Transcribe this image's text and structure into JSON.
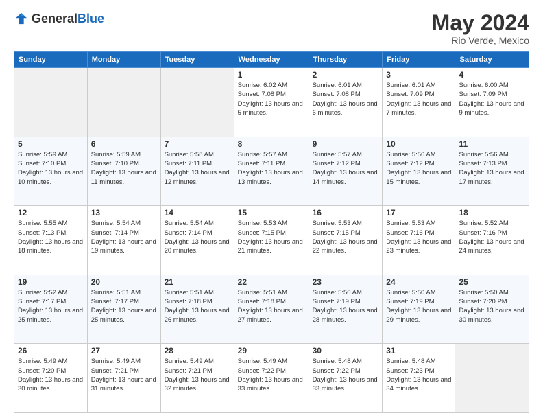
{
  "logo": {
    "general": "General",
    "blue": "Blue"
  },
  "header": {
    "month": "May 2024",
    "location": "Rio Verde, Mexico"
  },
  "weekdays": [
    "Sunday",
    "Monday",
    "Tuesday",
    "Wednesday",
    "Thursday",
    "Friday",
    "Saturday"
  ],
  "weeks": [
    [
      {
        "day": "",
        "empty": true
      },
      {
        "day": "",
        "empty": true
      },
      {
        "day": "",
        "empty": true
      },
      {
        "day": "1",
        "sunrise": "6:02 AM",
        "sunset": "7:08 PM",
        "daylight": "13 hours and 5 minutes."
      },
      {
        "day": "2",
        "sunrise": "6:01 AM",
        "sunset": "7:08 PM",
        "daylight": "13 hours and 6 minutes."
      },
      {
        "day": "3",
        "sunrise": "6:01 AM",
        "sunset": "7:09 PM",
        "daylight": "13 hours and 7 minutes."
      },
      {
        "day": "4",
        "sunrise": "6:00 AM",
        "sunset": "7:09 PM",
        "daylight": "13 hours and 9 minutes."
      }
    ],
    [
      {
        "day": "5",
        "sunrise": "5:59 AM",
        "sunset": "7:10 PM",
        "daylight": "13 hours and 10 minutes."
      },
      {
        "day": "6",
        "sunrise": "5:59 AM",
        "sunset": "7:10 PM",
        "daylight": "13 hours and 11 minutes."
      },
      {
        "day": "7",
        "sunrise": "5:58 AM",
        "sunset": "7:11 PM",
        "daylight": "13 hours and 12 minutes."
      },
      {
        "day": "8",
        "sunrise": "5:57 AM",
        "sunset": "7:11 PM",
        "daylight": "13 hours and 13 minutes."
      },
      {
        "day": "9",
        "sunrise": "5:57 AM",
        "sunset": "7:12 PM",
        "daylight": "13 hours and 14 minutes."
      },
      {
        "day": "10",
        "sunrise": "5:56 AM",
        "sunset": "7:12 PM",
        "daylight": "13 hours and 15 minutes."
      },
      {
        "day": "11",
        "sunrise": "5:56 AM",
        "sunset": "7:13 PM",
        "daylight": "13 hours and 17 minutes."
      }
    ],
    [
      {
        "day": "12",
        "sunrise": "5:55 AM",
        "sunset": "7:13 PM",
        "daylight": "13 hours and 18 minutes."
      },
      {
        "day": "13",
        "sunrise": "5:54 AM",
        "sunset": "7:14 PM",
        "daylight": "13 hours and 19 minutes."
      },
      {
        "day": "14",
        "sunrise": "5:54 AM",
        "sunset": "7:14 PM",
        "daylight": "13 hours and 20 minutes."
      },
      {
        "day": "15",
        "sunrise": "5:53 AM",
        "sunset": "7:15 PM",
        "daylight": "13 hours and 21 minutes."
      },
      {
        "day": "16",
        "sunrise": "5:53 AM",
        "sunset": "7:15 PM",
        "daylight": "13 hours and 22 minutes."
      },
      {
        "day": "17",
        "sunrise": "5:53 AM",
        "sunset": "7:16 PM",
        "daylight": "13 hours and 23 minutes."
      },
      {
        "day": "18",
        "sunrise": "5:52 AM",
        "sunset": "7:16 PM",
        "daylight": "13 hours and 24 minutes."
      }
    ],
    [
      {
        "day": "19",
        "sunrise": "5:52 AM",
        "sunset": "7:17 PM",
        "daylight": "13 hours and 25 minutes."
      },
      {
        "day": "20",
        "sunrise": "5:51 AM",
        "sunset": "7:17 PM",
        "daylight": "13 hours and 25 minutes."
      },
      {
        "day": "21",
        "sunrise": "5:51 AM",
        "sunset": "7:18 PM",
        "daylight": "13 hours and 26 minutes."
      },
      {
        "day": "22",
        "sunrise": "5:51 AM",
        "sunset": "7:18 PM",
        "daylight": "13 hours and 27 minutes."
      },
      {
        "day": "23",
        "sunrise": "5:50 AM",
        "sunset": "7:19 PM",
        "daylight": "13 hours and 28 minutes."
      },
      {
        "day": "24",
        "sunrise": "5:50 AM",
        "sunset": "7:19 PM",
        "daylight": "13 hours and 29 minutes."
      },
      {
        "day": "25",
        "sunrise": "5:50 AM",
        "sunset": "7:20 PM",
        "daylight": "13 hours and 30 minutes."
      }
    ],
    [
      {
        "day": "26",
        "sunrise": "5:49 AM",
        "sunset": "7:20 PM",
        "daylight": "13 hours and 30 minutes."
      },
      {
        "day": "27",
        "sunrise": "5:49 AM",
        "sunset": "7:21 PM",
        "daylight": "13 hours and 31 minutes."
      },
      {
        "day": "28",
        "sunrise": "5:49 AM",
        "sunset": "7:21 PM",
        "daylight": "13 hours and 32 minutes."
      },
      {
        "day": "29",
        "sunrise": "5:49 AM",
        "sunset": "7:22 PM",
        "daylight": "13 hours and 33 minutes."
      },
      {
        "day": "30",
        "sunrise": "5:48 AM",
        "sunset": "7:22 PM",
        "daylight": "13 hours and 33 minutes."
      },
      {
        "day": "31",
        "sunrise": "5:48 AM",
        "sunset": "7:23 PM",
        "daylight": "13 hours and 34 minutes."
      },
      {
        "day": "",
        "empty": true
      }
    ]
  ]
}
